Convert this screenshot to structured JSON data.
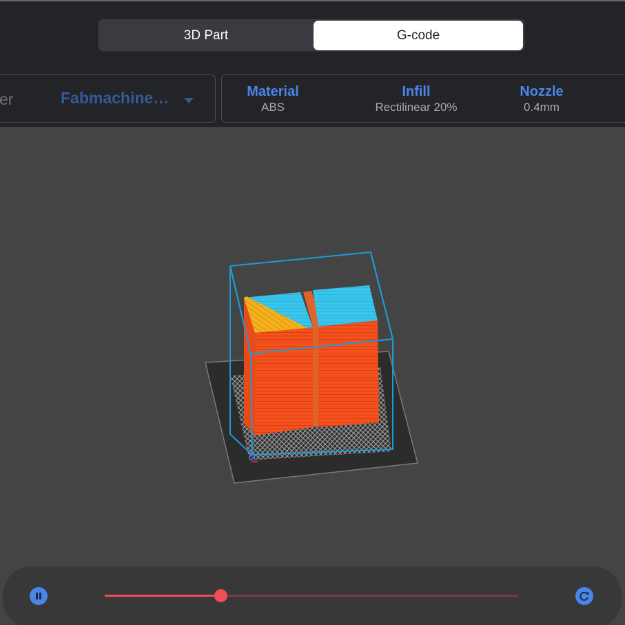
{
  "mode_switch": {
    "part_label": "3D Part",
    "gcode_label": "G-code",
    "active": "G-code"
  },
  "printer": {
    "label": "er",
    "selected": "Fabmachine…"
  },
  "settings": {
    "material": {
      "title": "Material",
      "value": "ABS"
    },
    "infill": {
      "title": "Infill",
      "value": "Rectilinear 20%"
    },
    "nozzle": {
      "title": "Nozzle",
      "value": "0.4mm"
    }
  },
  "playback": {
    "progress": 0.28
  },
  "icons": {
    "pause": "pause-icon",
    "refresh": "refresh-icon",
    "dropdown": "chevron-down-icon"
  },
  "colors": {
    "accent_blue": "#4a86e8",
    "slider_red": "#f24b59",
    "wall_orange": "#f4511e",
    "top_cyan": "#39c5ec",
    "infill_yellow": "#f6b21e",
    "bbox_blue": "#1e9bd7"
  }
}
